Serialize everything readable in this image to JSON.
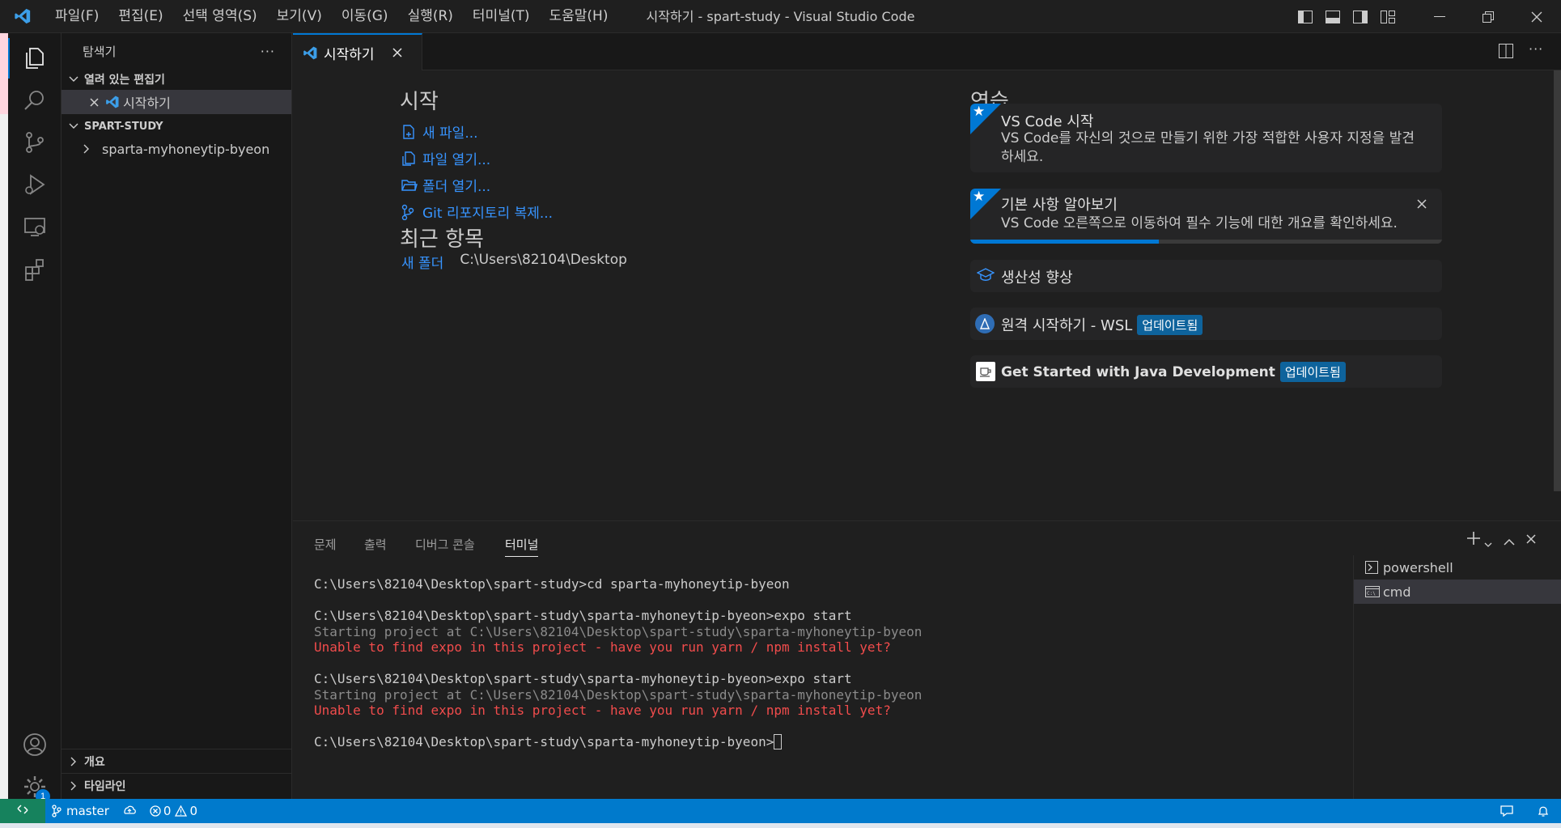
{
  "window": {
    "title": "시작하기 - spart-study - Visual Studio Code"
  },
  "menu": [
    "파일(F)",
    "편집(E)",
    "선택 영역(S)",
    "보기(V)",
    "이동(G)",
    "실행(R)",
    "터미널(T)",
    "도움말(H)"
  ],
  "sidebar": {
    "title": "탐색기",
    "more": "···",
    "open_editors": {
      "label": "열려 있는 편집기",
      "items": [
        {
          "name": "시작하기"
        }
      ]
    },
    "workspace": {
      "label": "SPART-STUDY",
      "items": [
        {
          "name": "sparta-myhoneytip-byeon"
        }
      ]
    },
    "outline": {
      "label": "개요"
    },
    "timeline": {
      "label": "타임라인"
    }
  },
  "activity": {
    "settings_badge": "1"
  },
  "editor": {
    "tab": {
      "label": "시작하기"
    },
    "start": {
      "heading": "시작",
      "links": [
        {
          "label": "새 파일...",
          "icon": "new-file-icon"
        },
        {
          "label": "파일 열기...",
          "icon": "open-file-icon"
        },
        {
          "label": "폴더 열기...",
          "icon": "open-folder-icon"
        },
        {
          "label": "Git 리포지토리 복제...",
          "icon": "git-clone-icon"
        }
      ]
    },
    "recent": {
      "heading": "최근 항목",
      "items": [
        {
          "name": "새 폴더",
          "path": "C:\\Users\\82104\\Desktop"
        }
      ]
    },
    "walkthroughs": {
      "heading": "연습",
      "cards": [
        {
          "title": "VS Code 시작",
          "desc": "VS Code를 자신의 것으로 만들기 위한 가장 적합한 사용자 지정을 발견하세요."
        },
        {
          "title": "기본 사항 알아보기",
          "desc": "VS Code 오른쪽으로 이동하여 필수 기능에 대한 개요를 확인하세요.",
          "progress": 0.4
        },
        {
          "title": "생산성 향상"
        },
        {
          "title": "원격 시작하기 - WSL",
          "tag": "업데이트됨"
        },
        {
          "title": "Get Started with Java Development",
          "tag": "업데이트됨"
        }
      ]
    }
  },
  "panel": {
    "tabs": [
      "문제",
      "출력",
      "디버그 콘솔",
      "터미널"
    ],
    "active_tab": "터미널",
    "terminal_lines": [
      {
        "text": "C:\\Users\\82104\\Desktop\\spart-study>cd sparta-myhoneytip-byeon",
        "kind": "w"
      },
      {
        "text": "C:\\Users\\82104\\Desktop\\spart-study\\sparta-myhoneytip-byeon>expo start",
        "kind": "w"
      },
      {
        "text": "Starting project at C:\\Users\\82104\\Desktop\\spart-study\\sparta-myhoneytip-byeon",
        "kind": "g"
      },
      {
        "text": "Unable to find expo in this project - have you run yarn / npm install yet?",
        "kind": "r"
      },
      {
        "text": "C:\\Users\\82104\\Desktop\\spart-study\\sparta-myhoneytip-byeon>expo start",
        "kind": "w"
      },
      {
        "text": "Starting project at C:\\Users\\82104\\Desktop\\spart-study\\sparta-myhoneytip-byeon",
        "kind": "g"
      },
      {
        "text": "Unable to find expo in this project - have you run yarn / npm install yet?",
        "kind": "r"
      },
      {
        "text": "C:\\Users\\82104\\Desktop\\spart-study\\sparta-myhoneytip-byeon>",
        "kind": "w"
      }
    ],
    "terminals": [
      {
        "name": "powershell"
      },
      {
        "name": "cmd"
      }
    ]
  },
  "statusbar": {
    "branch": "master",
    "errors": "0",
    "warnings": "0"
  },
  "colors": {
    "accent": "#0078d4",
    "status": "#007acc",
    "link": "#3794ff",
    "error": "#f14c4c"
  }
}
